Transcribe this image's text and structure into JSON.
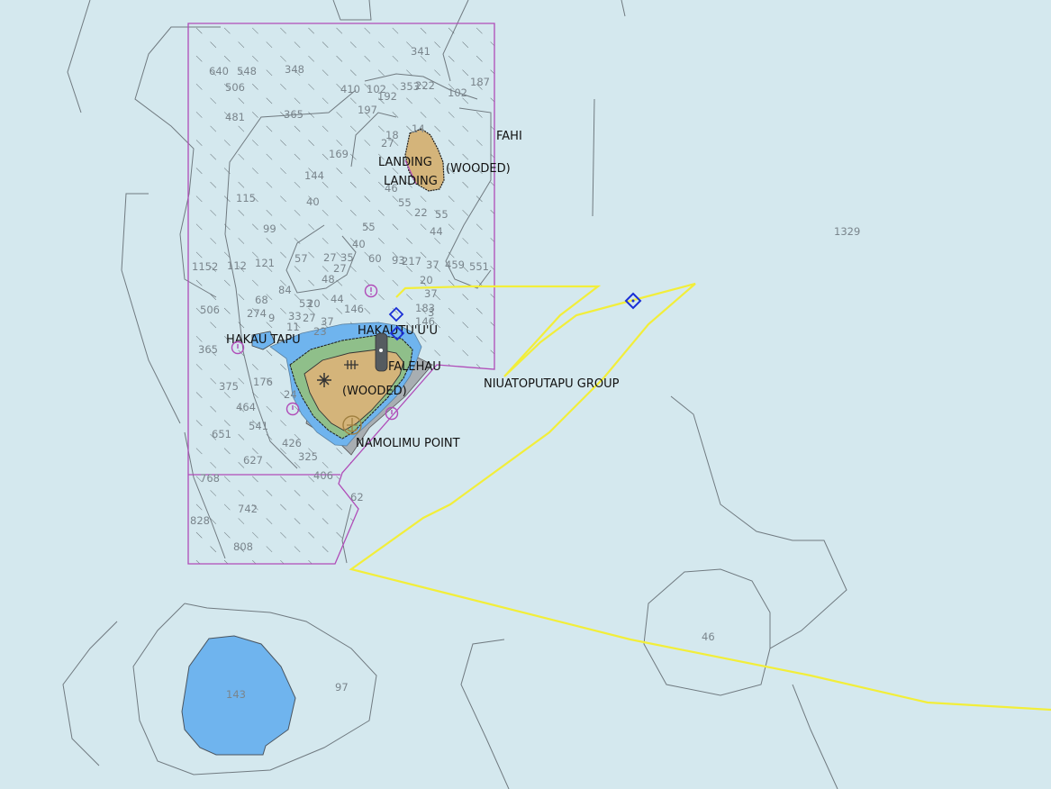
{
  "colors": {
    "sea": "#d4e8ee",
    "shallow_sea": "#6fb4ee",
    "land": "#d4b47a",
    "intertidal": "#8fbf8a",
    "restricted_boundary": "#b04cb8",
    "route": "#f2ee3a",
    "depth_contour": "#707a80",
    "sounding_text": "#7a858c",
    "label_text": "#111111",
    "navaid": "#1a2fd6"
  },
  "place_names": [
    "FAHI",
    "LANDING",
    "(WOODED)",
    "LANDING",
    "HAKAU TAPU",
    "HAKAUTU'U'U",
    "FALEHAU",
    "(WOODED)",
    "NIUATOPUTAPU GROUP",
    "NAMOLIMU POINT"
  ],
  "soundings": [
    "341",
    "640",
    "548",
    "348",
    "187",
    "506",
    "410",
    "102",
    "192",
    "353",
    "222",
    "102",
    "481",
    "365",
    "197",
    "18",
    "14",
    "27",
    "169",
    "144",
    "46",
    "55",
    "22",
    "55",
    "115",
    "40",
    "99",
    "55",
    "44",
    "40",
    "1152",
    "112",
    "121",
    "57",
    "27",
    "35",
    "60",
    "93",
    "217",
    "37",
    "459",
    "551",
    "1329",
    "84",
    "48",
    "27",
    "20",
    "68",
    "506",
    "53",
    "20",
    "44",
    "37",
    "274",
    "9",
    "33",
    "27",
    "37",
    "146",
    "183",
    "3",
    "146",
    "11",
    "365",
    "375",
    "176",
    "464",
    "541",
    "651",
    "426",
    "627",
    "325",
    "406",
    "768",
    "62",
    "742",
    "828",
    "808",
    "46",
    "143",
    "97",
    "24",
    "23"
  ],
  "icons": [
    "caution-icon",
    "navaid-diamond-icon",
    "lighthouse-icon",
    "wreck-icon",
    "anchorage-icon",
    "waypoint-icon"
  ]
}
